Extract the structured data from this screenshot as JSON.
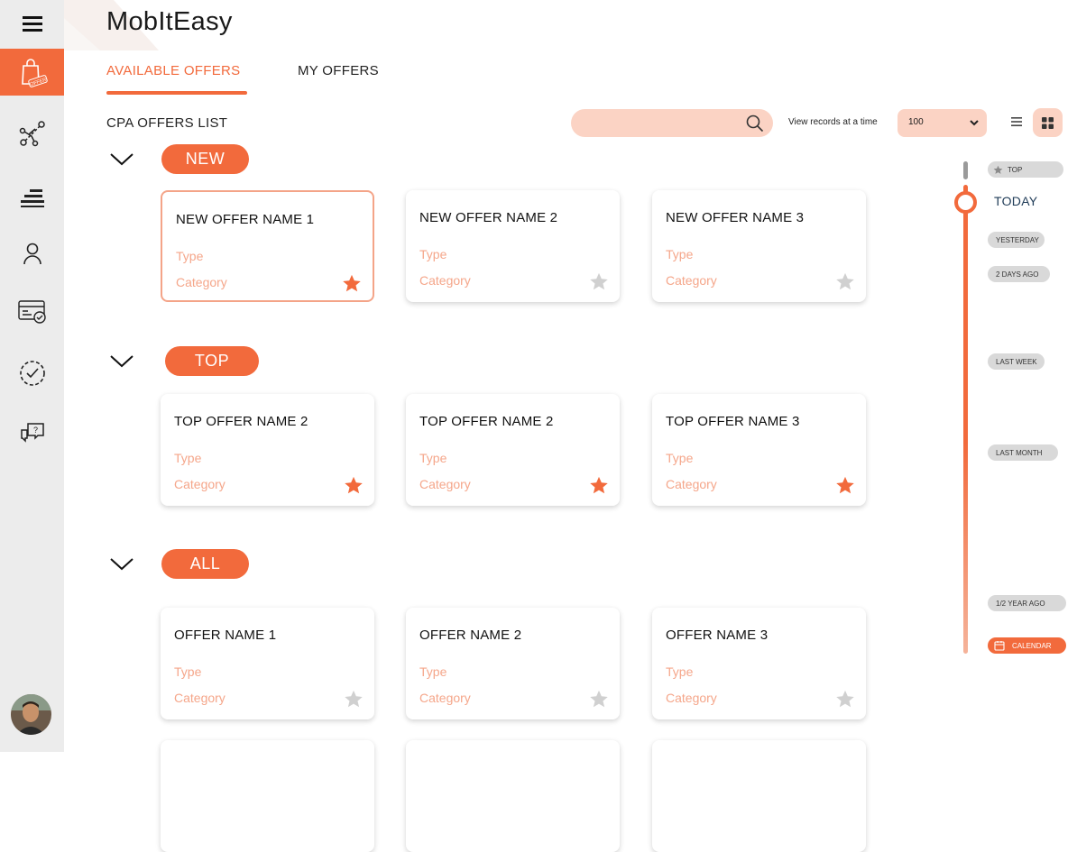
{
  "app": {
    "title": "MobItEasy"
  },
  "sidebar": {
    "menu_icon": "hamburger-icon",
    "items": [
      {
        "name": "offers",
        "icon": "shopping-bag-offer-icon",
        "badge": "OFFER",
        "active": true
      },
      {
        "name": "links",
        "icon": "connections-icon"
      },
      {
        "name": "reports",
        "icon": "stacked-bars-icon"
      },
      {
        "name": "profile",
        "icon": "user-icon"
      },
      {
        "name": "billing",
        "icon": "card-check-icon"
      },
      {
        "name": "tasks",
        "icon": "check-circle-icon"
      },
      {
        "name": "support",
        "icon": "chat-question-icon"
      }
    ],
    "avatar": "user-avatar"
  },
  "tabs": [
    {
      "label": "AVAILABLE OFFERS",
      "active": true
    },
    {
      "label": "MY OFFERS",
      "active": false
    }
  ],
  "toolbar": {
    "list_title": "CPA OFFERS LIST",
    "search_placeholder": "",
    "view_label": "View  records at a time",
    "records_value": "100"
  },
  "sections": [
    {
      "label": "NEW",
      "cards": [
        {
          "name": "NEW OFFER NAME 1",
          "type": "Type",
          "category": "Category",
          "starred": true,
          "selected": true
        },
        {
          "name": "NEW OFFER NAME 2",
          "type": "Type",
          "category": "Category",
          "starred": false
        },
        {
          "name": "NEW OFFER NAME 3",
          "type": "Type",
          "category": "Category",
          "starred": false
        }
      ]
    },
    {
      "label": "TOP",
      "cards": [
        {
          "name": "TOP OFFER NAME 2",
          "type": "Type",
          "category": "Category",
          "starred": true
        },
        {
          "name": "TOP OFFER NAME 2",
          "type": "Type",
          "category": "Category",
          "starred": true
        },
        {
          "name": "TOP OFFER NAME 3",
          "type": "Type",
          "category": "Category",
          "starred": true
        }
      ]
    },
    {
      "label": "ALL",
      "cards": [
        {
          "name": "OFFER NAME 1",
          "type": "Type",
          "category": "Category",
          "starred": false
        },
        {
          "name": "OFFER NAME 2",
          "type": "Type",
          "category": "Category",
          "starred": false
        },
        {
          "name": "OFFER NAME 3",
          "type": "Type",
          "category": "Category",
          "starred": false
        }
      ]
    }
  ],
  "timeline": {
    "top_label": "TOP",
    "today_label": "TODAY",
    "yesterday": "YESTERDAY",
    "two_days": "2 DAYS AGO",
    "last_week": "LAST WEEK",
    "last_month": "LAST MONTH",
    "half_year": "1/2 YEAR AGO",
    "calendar": "CALENDAR"
  },
  "colors": {
    "accent": "#f26a3c",
    "accent_light": "#fbd3c4",
    "muted_text": "#f5a68a",
    "star_inactive": "#d0d0d0"
  }
}
